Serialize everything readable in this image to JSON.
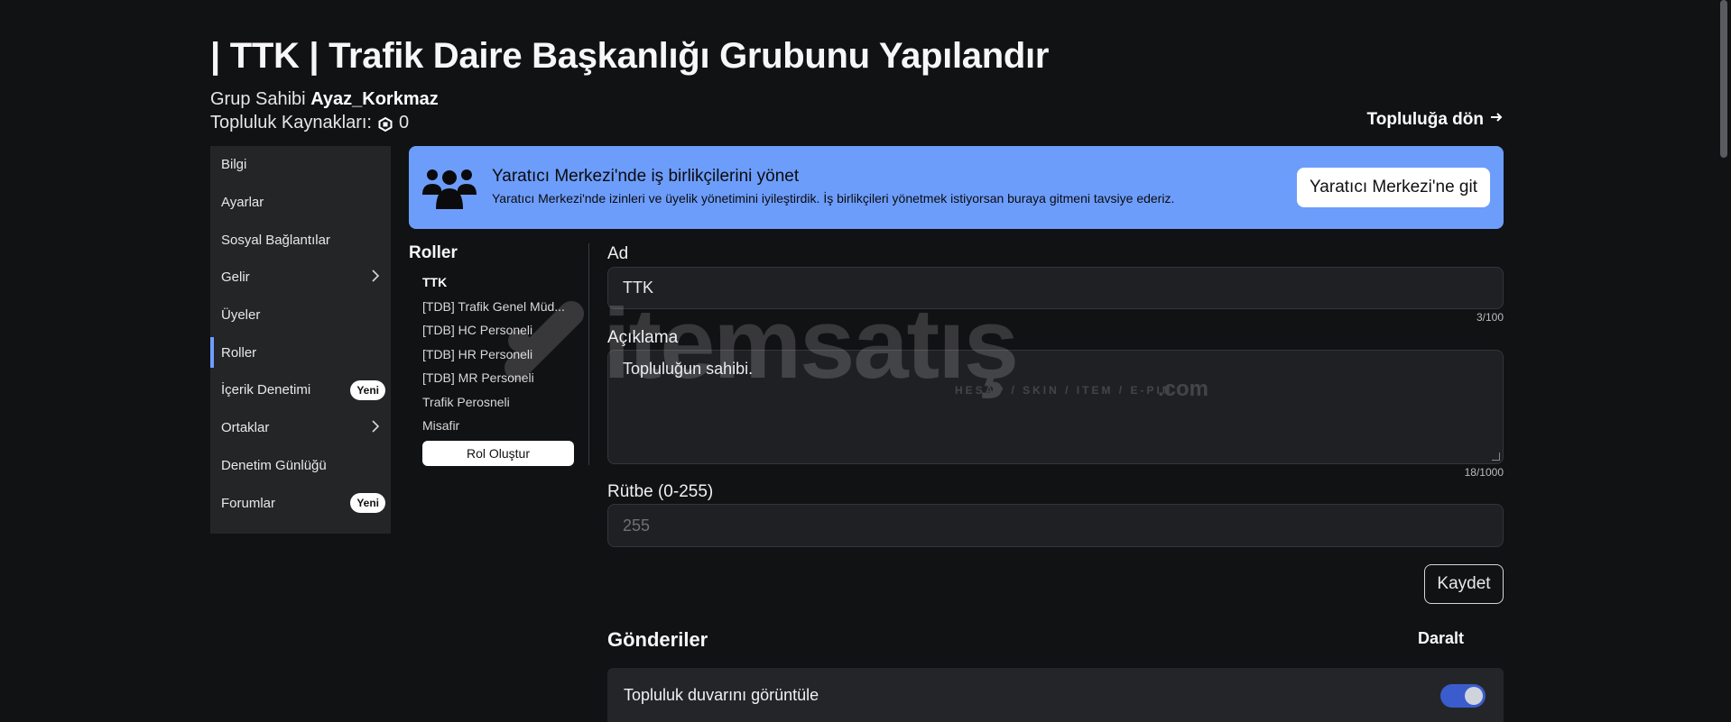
{
  "header": {
    "title": "| TTK | Trafik Daire Başkanlığı Grubunu Yapılandır",
    "owner_label": "Grup Sahibi",
    "owner_name": "Ayaz_Korkmaz",
    "funds_label": "Topluluk Kaynakları:",
    "funds_value": "0",
    "back_link": "Topluluğa dön"
  },
  "sidebar": {
    "items": [
      {
        "label": "Bilgi"
      },
      {
        "label": "Ayarlar"
      },
      {
        "label": "Sosyal Bağlantılar"
      },
      {
        "label": "Gelir"
      },
      {
        "label": "Üyeler"
      },
      {
        "label": "Roller"
      },
      {
        "label": "İçerik Denetimi",
        "badge": "Yeni"
      },
      {
        "label": "Ortaklar"
      },
      {
        "label": "Denetim Günlüğü"
      },
      {
        "label": "Forumlar",
        "badge": "Yeni"
      }
    ],
    "active": "Roller"
  },
  "banner": {
    "title": "Yaratıcı Merkezi'nde iş birlikçilerini yönet",
    "description": "Yaratıcı Merkezi'nde izinleri ve üyelik yönetimini iyileştirdik. İş birlikçileri yönetmek istiyorsan buraya gitmeni tavsiye ederiz.",
    "button": "Yaratıcı Merkezi'ne git"
  },
  "roles": {
    "title": "Roller",
    "items": [
      "TTK",
      "[TDB] Trafik Genel Müd...",
      "[TDB] HC Personeli",
      "[TDB] HR Personeli",
      "[TDB] MR Personeli",
      "Trafik Perosneli",
      "Misafir"
    ],
    "selected": "TTK",
    "create_button": "Rol Oluştur"
  },
  "form": {
    "name_label": "Ad",
    "name_value": "TTK",
    "name_counter": "3/100",
    "description_label": "Açıklama",
    "description_value": "Topluluğun sahibi.",
    "description_counter": "18/1000",
    "rank_label": "Rütbe (0-255)",
    "rank_value": "255",
    "save_button": "Kaydet"
  },
  "posts": {
    "title": "Gönderiler",
    "collapse": "Daralt",
    "permission_label": "Topluluk duvarını görüntüle",
    "permission_enabled": true
  },
  "watermark": {
    "brand": "itemsatış",
    "sub": "HESAP / SKIN / ITEM / E-PIN",
    "domain": ".com"
  },
  "colors": {
    "background": "#111214",
    "banner": "#6d9dfb",
    "accent": "#6f9cff",
    "toggle": "#3b5ccc"
  }
}
